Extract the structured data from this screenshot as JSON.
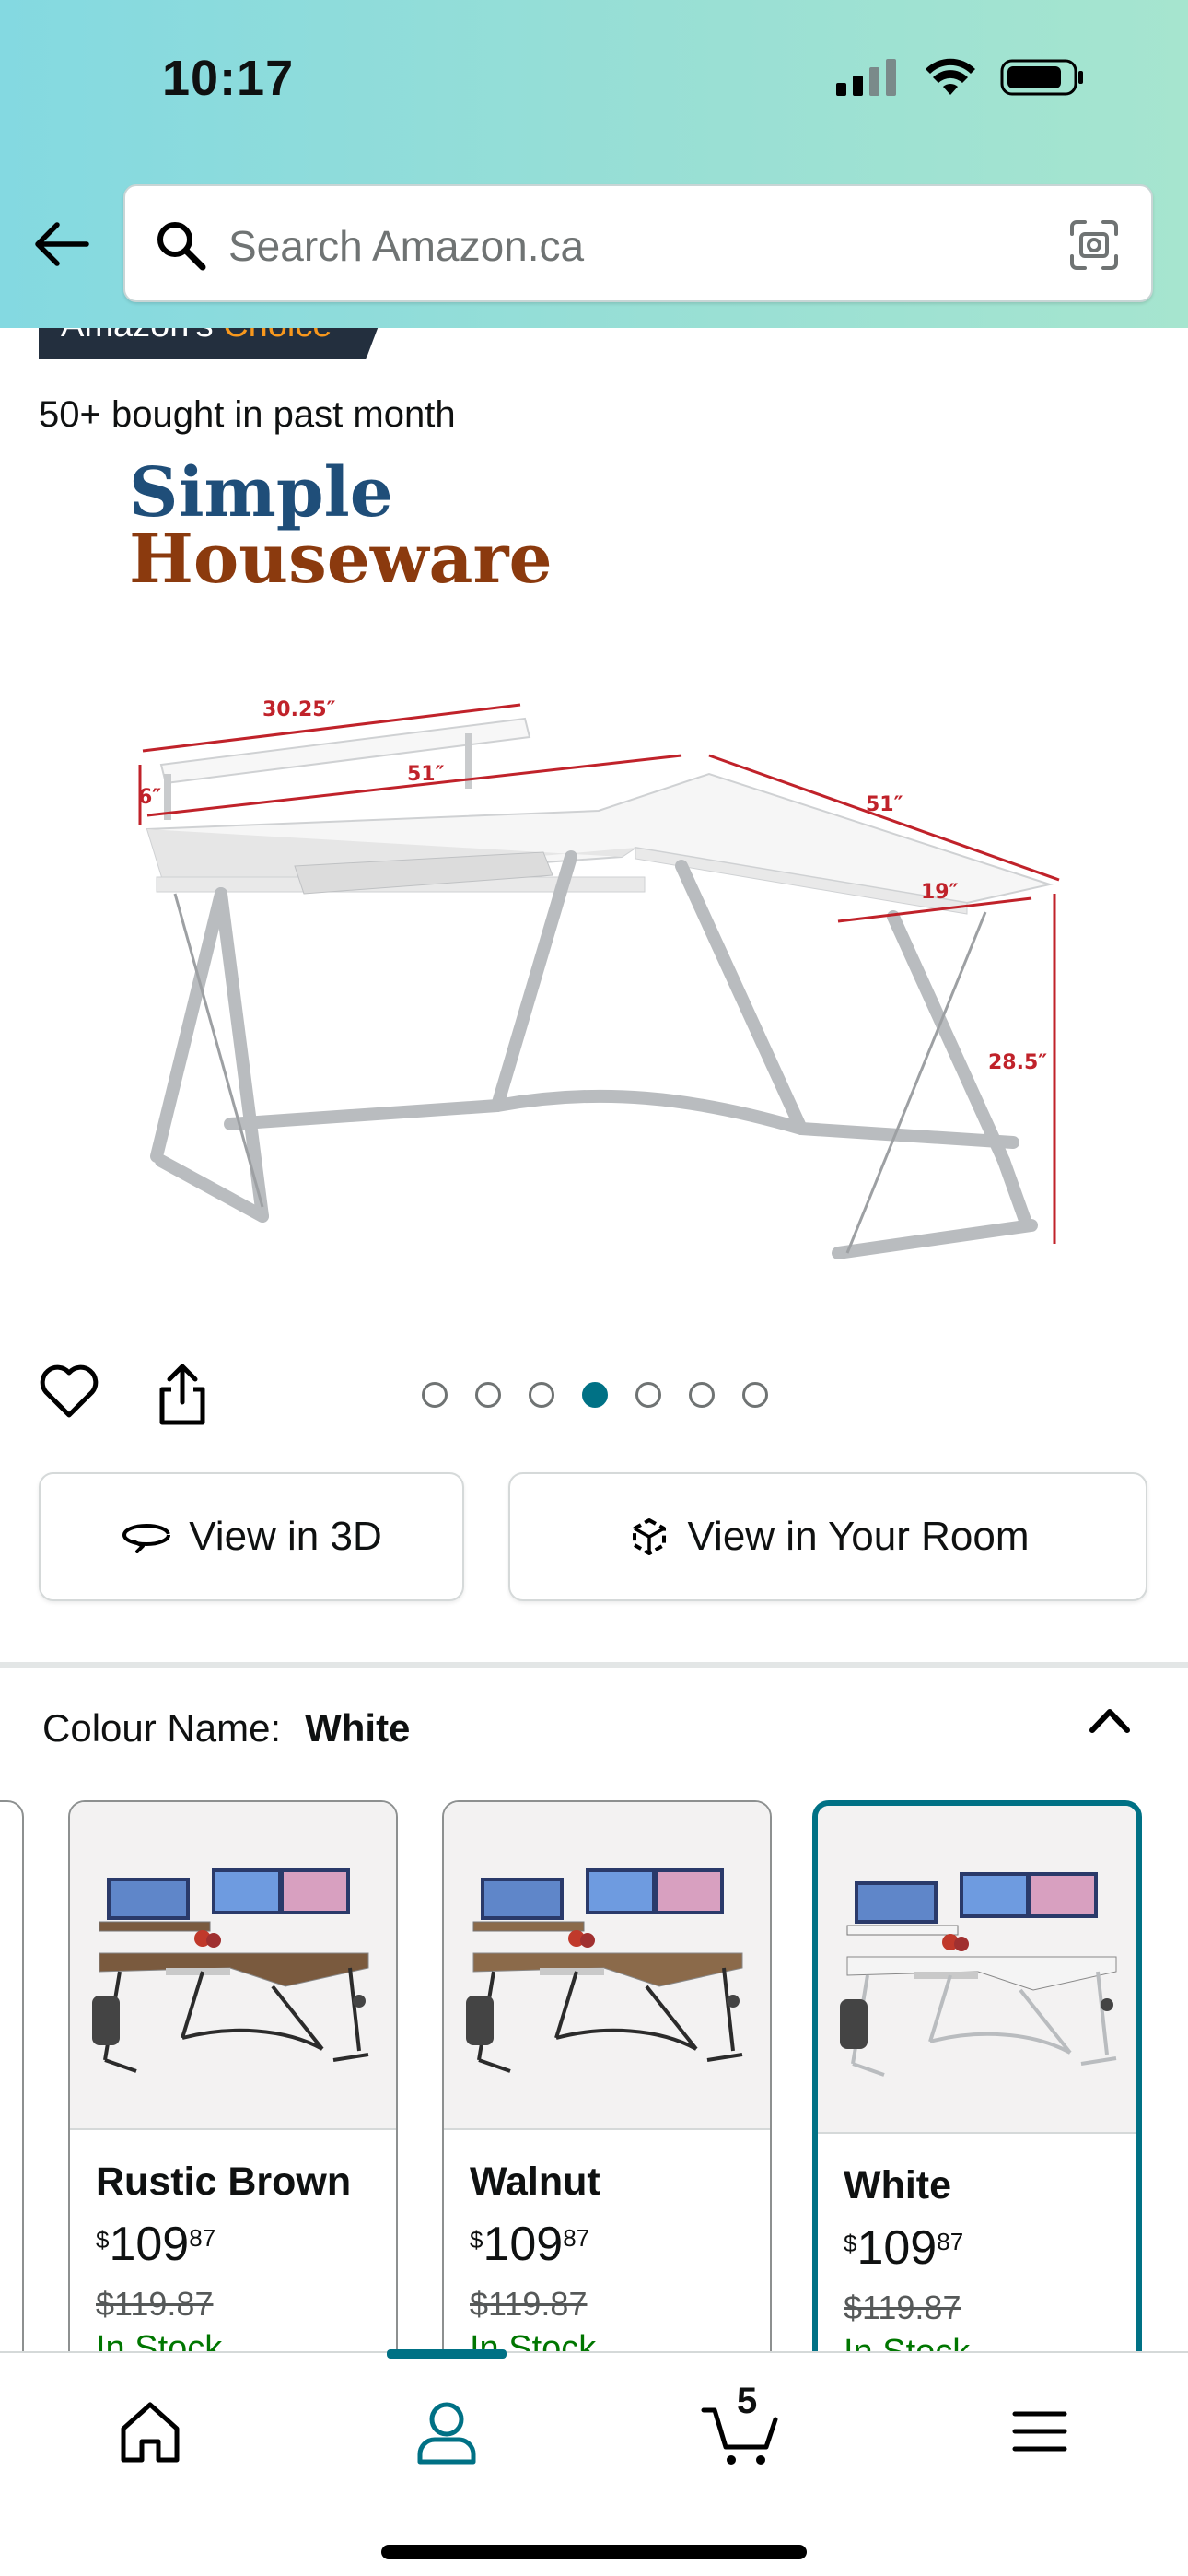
{
  "status_bar": {
    "time": "10:17"
  },
  "search": {
    "placeholder": "Search Amazon.ca"
  },
  "badge": {
    "prefix": "Amazon's",
    "highlight": "Choice"
  },
  "bought_text": "50+ bought in past month",
  "product_image": {
    "brand_line1": "Simple",
    "brand_line2": "Houseware",
    "dimensions": {
      "shelf_width": "30.25″",
      "shelf_height": "6″",
      "desk_width": "51″",
      "return_width": "51″",
      "depth": "19″",
      "height": "28.5″"
    }
  },
  "carousel": {
    "total": 7,
    "active": 4
  },
  "buttons": {
    "view_3d": "View in 3D",
    "view_room": "View in Your Room"
  },
  "colour": {
    "label": "Colour Name:",
    "value": "White"
  },
  "swatches": [
    {
      "name": "Rustic Brown",
      "currency": "$",
      "whole": "109",
      "fraction": "87",
      "old_price": "$119.87",
      "stock": "In Stock",
      "top": "#7a5a3e",
      "frame": "#2b2b2b"
    },
    {
      "name": "Walnut",
      "currency": "$",
      "whole": "109",
      "fraction": "87",
      "old_price": "$119.87",
      "stock": "In Stock",
      "top": "#8b6a4a",
      "frame": "#2b2b2b"
    },
    {
      "name": "White",
      "currency": "$",
      "whole": "109",
      "fraction": "87",
      "old_price": "$119.87",
      "stock": "In Stock",
      "top": "#f4f4f4",
      "frame": "#b9bcbf"
    }
  ],
  "bottom_nav": {
    "cart_count": "5",
    "active": "account"
  },
  "colors": {
    "accent": "#007185",
    "badge_bg": "#232f3e",
    "choice_orange": "#f8981d",
    "dimension_red": "#c0222a"
  }
}
